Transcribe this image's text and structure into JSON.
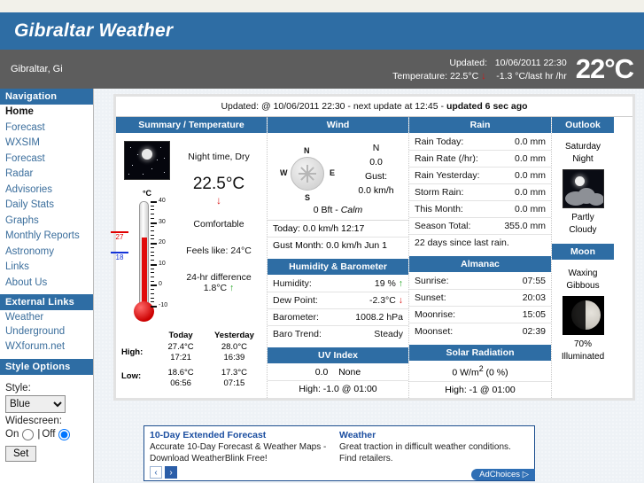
{
  "header": {
    "site_title": "Gibraltar Weather",
    "location": "Gibraltar, Gi",
    "updated_label": "Updated:",
    "updated_value": "10/06/2011 22:30",
    "temperature_label": "Temperature:",
    "temperature_value": "22.5°C",
    "trend_arrow": "↓",
    "trend_value": "-1.3 °C/last hr /hr",
    "big_temp": "22°C",
    "accent_blue": "#2e6da4",
    "gray_bar": "#5d5d5d"
  },
  "sidebar": {
    "nav_heading": "Navigation",
    "nav_items": [
      "Home",
      "Forecast",
      "WXSIM",
      "Forecast",
      "Radar",
      "Advisories",
      "Daily Stats",
      "Graphs",
      "Monthly Reports",
      "Astronomy",
      "Links",
      "About Us"
    ],
    "external_heading": "External Links",
    "external_items": [
      "Weather Underground",
      "WXforum.net"
    ],
    "style_heading": "Style Options",
    "style_label": "Style:",
    "style_selected": "Blue",
    "style_options": [
      "Blue"
    ],
    "widescreen_label": "Widescreen:",
    "widescreen_on": "On",
    "widescreen_sep": "|",
    "widescreen_off": "Off",
    "set_button": "Set"
  },
  "updated_bar": {
    "text": "Updated: @ 10/06/2011 22:30 - next update at 12:45",
    "dash": " - ",
    "bold": "updated 6 sec ago"
  },
  "panels": {
    "summary": {
      "title": "Summary / Temperature",
      "condition": "Night time, Dry",
      "temperature": "22.5°C",
      "trend_arrow": "↓",
      "comfort": "Comfortable",
      "feels_like": "Feels like: 24°C",
      "diff_label": "24-hr difference",
      "diff_value": "1.8°C",
      "diff_arrow": "↑",
      "thermo_unit": "°C",
      "thermo_min": -10,
      "thermo_max": 40,
      "thermo_value": 22.5,
      "thermo_high_mark": "27",
      "thermo_low_mark": "18",
      "table": {
        "col_today": "Today",
        "col_yesterday": "Yesterday",
        "high_label": "High:",
        "high_today": "27.4°C",
        "high_today_time": "17:21",
        "high_yest": "28.0°C",
        "high_yest_time": "16:39",
        "low_label": "Low:",
        "low_today": "18.6°C",
        "low_today_time": "06:56",
        "low_yest": "17.3°C",
        "low_yest_time": "07:15"
      }
    },
    "wind": {
      "title": "Wind",
      "direction": "N",
      "speed": "0.0",
      "gust_label": "Gust:",
      "gust_value": "0.0 km/h",
      "beaufort": "0 Bft - ",
      "beaufort_desc": "Calm",
      "today": "Today: 0.0 km/h 12:17",
      "gust_month": "Gust Month: 0.0 km/h Jun 1",
      "compass_n": "N",
      "compass_e": "E",
      "compass_s": "S",
      "compass_w": "W"
    },
    "rain": {
      "title": "Rain",
      "rows": [
        {
          "label": "Rain Today:",
          "value": "0.0 mm"
        },
        {
          "label": "Rain Rate (/hr):",
          "value": "0.0 mm"
        },
        {
          "label": "Rain Yesterday:",
          "value": "0.0 mm"
        },
        {
          "label": "Storm Rain:",
          "value": "0.0 mm"
        },
        {
          "label": "This Month:",
          "value": "0.0 mm"
        },
        {
          "label": "Season Total:",
          "value": "355.0 mm"
        }
      ],
      "footer": "22 days since last rain."
    },
    "humidity": {
      "title": "Humidity & Barometer",
      "humidity_label": "Humidity:",
      "humidity_value": "19 %",
      "humidity_arrow": "↑",
      "dew_label": "Dew Point:",
      "dew_value": "-2.3°C",
      "dew_arrow": "↓",
      "baro_label": "Barometer:",
      "baro_value": "1008.2 hPa",
      "trend_label": "Baro Trend:",
      "trend_value": "Steady"
    },
    "uv": {
      "title": "UV Index",
      "value": "0.0",
      "desc": "None",
      "high": "High: -1.0 @ 01:00"
    },
    "almanac": {
      "title": "Almanac",
      "rows": [
        {
          "label": "Sunrise:",
          "value": "07:55"
        },
        {
          "label": "Sunset:",
          "value": "20:03"
        },
        {
          "label": "Moonrise:",
          "value": "15:05"
        },
        {
          "label": "Moonset:",
          "value": "02:39"
        }
      ]
    },
    "solar": {
      "title": "Solar Radiation",
      "value": "0 W/m",
      "sup": "2",
      "pct": " (0 %)",
      "high": "High: -1 @  01:00"
    },
    "outlook": {
      "title": "Outlook",
      "day": "Saturday",
      "period": "Night",
      "desc_line1": "Partly",
      "desc_line2": "Cloudy"
    },
    "moon": {
      "title": "Moon",
      "phase_line1": "Waxing",
      "phase_line2": "Gibbous",
      "illum_line1": "70%",
      "illum_line2": "Illuminated"
    }
  },
  "ad": {
    "left_title": "10-Day Extended Forecast",
    "left_text": "Accurate 10-Day Forecast & Weather Maps - Download WeatherBlink Free!",
    "right_title": "Weather",
    "right_text": "Great traction in difficult weather conditions. Find retailers.",
    "prev": "‹",
    "next": "›",
    "adchoices": "AdChoices ▷"
  }
}
